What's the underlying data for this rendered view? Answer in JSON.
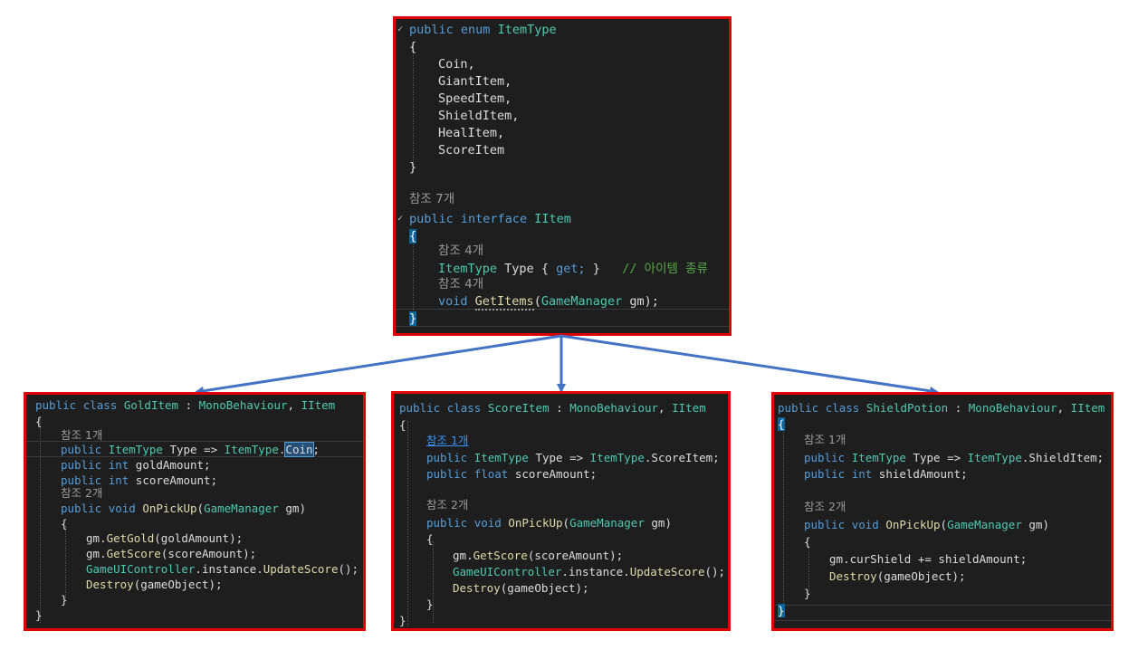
{
  "colors": {
    "border": "#e00000",
    "editor_bg": "#1e1e1e",
    "arrow": "#4472c4",
    "keyword": "#569cd6",
    "type": "#4ec9b0",
    "method": "#dcdcaa",
    "comment": "#57a64a",
    "codelens": "#999999"
  },
  "top": {
    "enum_decl": {
      "kw1": "public",
      "kw2": "enum",
      "name": "ItemType"
    },
    "open_brace": "{",
    "enum_members": [
      "Coin,",
      "GiantItem,",
      "SpeedItem,",
      "ShieldItem,",
      "HealItem,",
      "ScoreItem"
    ],
    "close_brace": "}",
    "ref_interface": "참조 7개",
    "interface_decl": {
      "kw1": "public",
      "kw2": "interface",
      "name": "IItem"
    },
    "iface_open": "{",
    "ref_type": "참조 4개",
    "type_prop": {
      "type": "ItemType",
      "name": "Type",
      "ob": "{",
      "get": "get;",
      "cb": "}",
      "comment": "// 아이템 종류"
    },
    "ref_method": "참조 4개",
    "method": {
      "ret": "void",
      "name": "GetItems",
      "po": "(",
      "ptype": "GameManager",
      "pname": "gm",
      "pc": ");"
    },
    "iface_close": "}"
  },
  "gold": {
    "decl": {
      "kw1": "public",
      "kw2": "class",
      "name": "GoldItem",
      "colon": ":",
      "base": "MonoBehaviour",
      "comma": ",",
      "iface": "IItem"
    },
    "open": "{",
    "ref1": "참조 1개",
    "type_line": {
      "kw": "public",
      "type": "ItemType",
      "name": "Type",
      "arrow": "=>",
      "enum": "ItemType",
      "dot": ".",
      "member": "Coin",
      "semi": ";"
    },
    "field1": {
      "kw": "public",
      "type": "int",
      "name": "goldAmount;"
    },
    "field2": {
      "kw": "public",
      "type": "int",
      "name": "scoreAmount;"
    },
    "ref2": "참조 2개",
    "method_decl": {
      "kw": "public",
      "ret": "void",
      "name": "OnPickUp",
      "po": "(",
      "ptype": "GameManager",
      "pname": "gm",
      "pc": ")"
    },
    "m_open": "{",
    "body": [
      {
        "obj": "gm",
        "dot": ".",
        "fn": "GetGold",
        "args": "(goldAmount);"
      },
      {
        "obj": "gm",
        "dot": ".",
        "fn": "GetScore",
        "args": "(scoreAmount);"
      },
      {
        "obj": "GameUIController",
        "dot": ".instance.",
        "fn": "UpdateScore",
        "args": "();"
      },
      {
        "obj": "",
        "dot": "",
        "fn": "Destroy",
        "args": "(gameObject);"
      }
    ],
    "m_close": "}",
    "close": "}"
  },
  "score": {
    "decl": {
      "kw1": "public",
      "kw2": "class",
      "name": "ScoreItem",
      "colon": ":",
      "base": "MonoBehaviour",
      "comma": ",",
      "iface": "IItem"
    },
    "open": "{",
    "ref1": "참조 1개",
    "type_line": {
      "kw": "public",
      "type": "ItemType",
      "name": "Type",
      "arrow": "=>",
      "enum": "ItemType",
      "member": ".ScoreItem;"
    },
    "field1": {
      "kw": "public",
      "type": "float",
      "name": "scoreAmount;"
    },
    "ref2": "참조 2개",
    "method_decl": {
      "kw": "public",
      "ret": "void",
      "name": "OnPickUp",
      "po": "(",
      "ptype": "GameManager",
      "pname": "gm",
      "pc": ")"
    },
    "m_open": "{",
    "body": [
      {
        "obj": "gm",
        "dot": ".",
        "fn": "GetScore",
        "args": "(scoreAmount);"
      },
      {
        "obj": "GameUIController",
        "dot": ".instance.",
        "fn": "UpdateScore",
        "args": "();"
      },
      {
        "obj": "",
        "dot": "",
        "fn": "Destroy",
        "args": "(gameObject);"
      }
    ],
    "m_close": "}",
    "close": "}"
  },
  "shield": {
    "decl": {
      "kw1": "public",
      "kw2": "class",
      "name": "ShieldPotion",
      "colon": ":",
      "base": "MonoBehaviour",
      "comma": ",",
      "iface": "IItem"
    },
    "open": "{",
    "ref1": "참조 1개",
    "type_line": {
      "kw": "public",
      "type": "ItemType",
      "name": "Type",
      "arrow": "=>",
      "enum": "ItemType",
      "member": ".ShieldItem;"
    },
    "field1": {
      "kw": "public",
      "type": "int",
      "name": "shieldAmount;"
    },
    "ref2": "참조 2개",
    "method_decl": {
      "kw": "public",
      "ret": "void",
      "name": "OnPickUp",
      "po": "(",
      "ptype": "GameManager",
      "pname": "gm",
      "pc": ")"
    },
    "m_open": "{",
    "body": [
      {
        "obj": "gm",
        "dot": ".",
        "fn": "curShield",
        "args": " += shieldAmount;"
      },
      {
        "obj": "",
        "dot": "",
        "fn": "Destroy",
        "args": "(gameObject);"
      }
    ],
    "m_close": "}",
    "close": "}"
  }
}
